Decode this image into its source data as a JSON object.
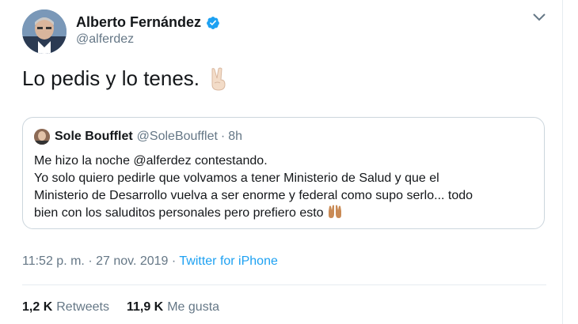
{
  "author": {
    "name": "Alberto Fernández",
    "handle": "@alferdez"
  },
  "tweet": {
    "text": "Lo pedis y lo tenes.",
    "emoji": "victory-hand"
  },
  "quoted": {
    "name": "Sole Boufflet",
    "handle": "@SoleBoufflet",
    "separator": "·",
    "time": "8h",
    "lines": [
      "Me hizo la noche @alferdez contestando.",
      "Yo solo quiero pedirle que volvamos a tener Ministerio de Salud y que el",
      "Ministerio de Desarrollo vuelva a ser enorme y federal como supo serlo... todo",
      "bien con los saluditos personales pero prefiero esto"
    ],
    "emoji": "raising-hands"
  },
  "meta": {
    "time": "11:52 p. m.",
    "sep": "·",
    "date": "27 nov. 2019",
    "source": "Twitter for iPhone"
  },
  "stats": {
    "retweets_count": "1,2 K",
    "retweets_label": "Retweets",
    "likes_count": "11,9 K",
    "likes_label": "Me gusta"
  },
  "colors": {
    "accent": "#1da1f2",
    "secondary_text": "#657786",
    "border": "#ccd6dd"
  }
}
